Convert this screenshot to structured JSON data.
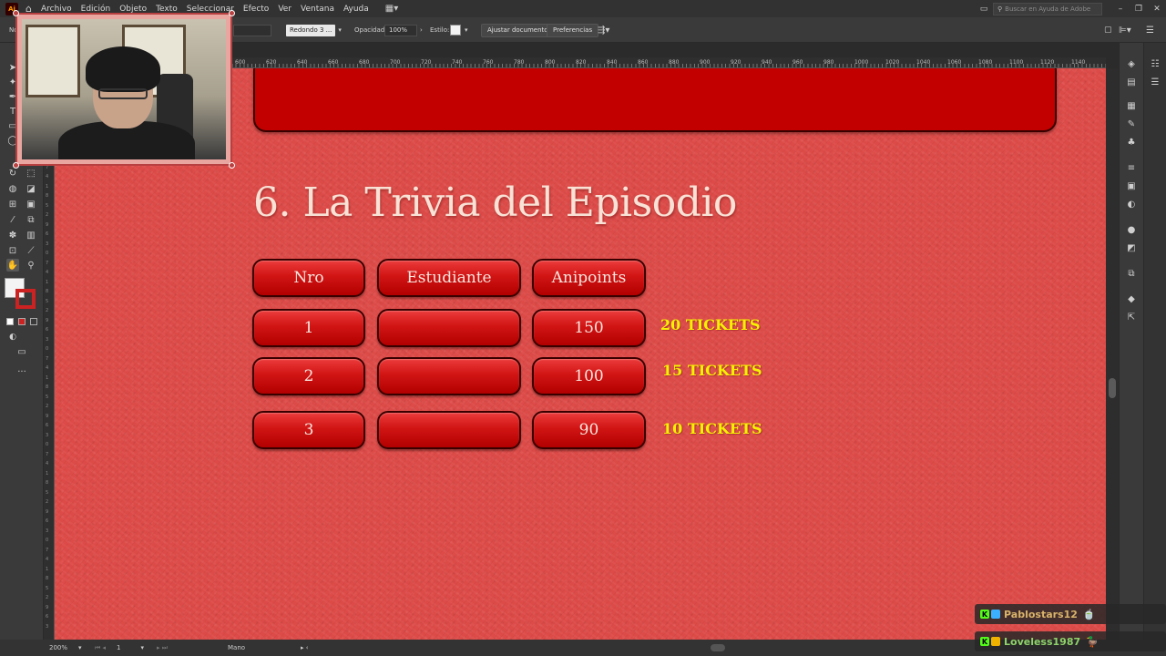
{
  "menubar": {
    "logo": "Ai",
    "items": [
      "Archivo",
      "Edición",
      "Objeto",
      "Texto",
      "Seleccionar",
      "Efecto",
      "Ver",
      "Ventana",
      "Ayuda"
    ],
    "search_placeholder": "Buscar en Ayuda de Adobe"
  },
  "controlbar": {
    "left_label": "No",
    "brush": "Redondo 3 ...",
    "opacity_label": "Opacidad:",
    "opacity_value": "100%",
    "style_label": "Estilo:",
    "ajustar_button": "Ajustar documento",
    "preferences_button": "Preferencias"
  },
  "ruler": {
    "labels": [
      "600",
      "620",
      "640",
      "660",
      "680",
      "700",
      "720",
      "740",
      "760",
      "780",
      "800",
      "820",
      "840",
      "860",
      "880",
      "900",
      "920",
      "940",
      "960",
      "980",
      "1000",
      "1020",
      "1040",
      "1060",
      "1080",
      "1100",
      "1120",
      "1140"
    ]
  },
  "artboard": {
    "title": "6. La Trivia del Episodio",
    "headers": [
      "Nro",
      "Estudiante",
      "Anipoints"
    ],
    "rows": [
      {
        "nro": "1",
        "student": "",
        "points": "150",
        "tickets": "20 TICKETS"
      },
      {
        "nro": "2",
        "student": "",
        "points": "100",
        "tickets": "15 TICKETS"
      },
      {
        "nro": "3",
        "student": "",
        "points": "90",
        "tickets": "10 TICKETS"
      }
    ]
  },
  "statusbar": {
    "zoom": "200%",
    "artboard_number": "1",
    "tool_name": "Mano"
  },
  "chat": {
    "users": [
      {
        "name": "Pablostars12",
        "color": "#d9b36a"
      },
      {
        "name": "Loveless1987",
        "color": "#8fd36a"
      }
    ]
  },
  "colors": {
    "canvas": "#dd4b48",
    "pill": "#c20000",
    "ticket_text": "#f6f200",
    "title_text": "#f8e2d6"
  }
}
